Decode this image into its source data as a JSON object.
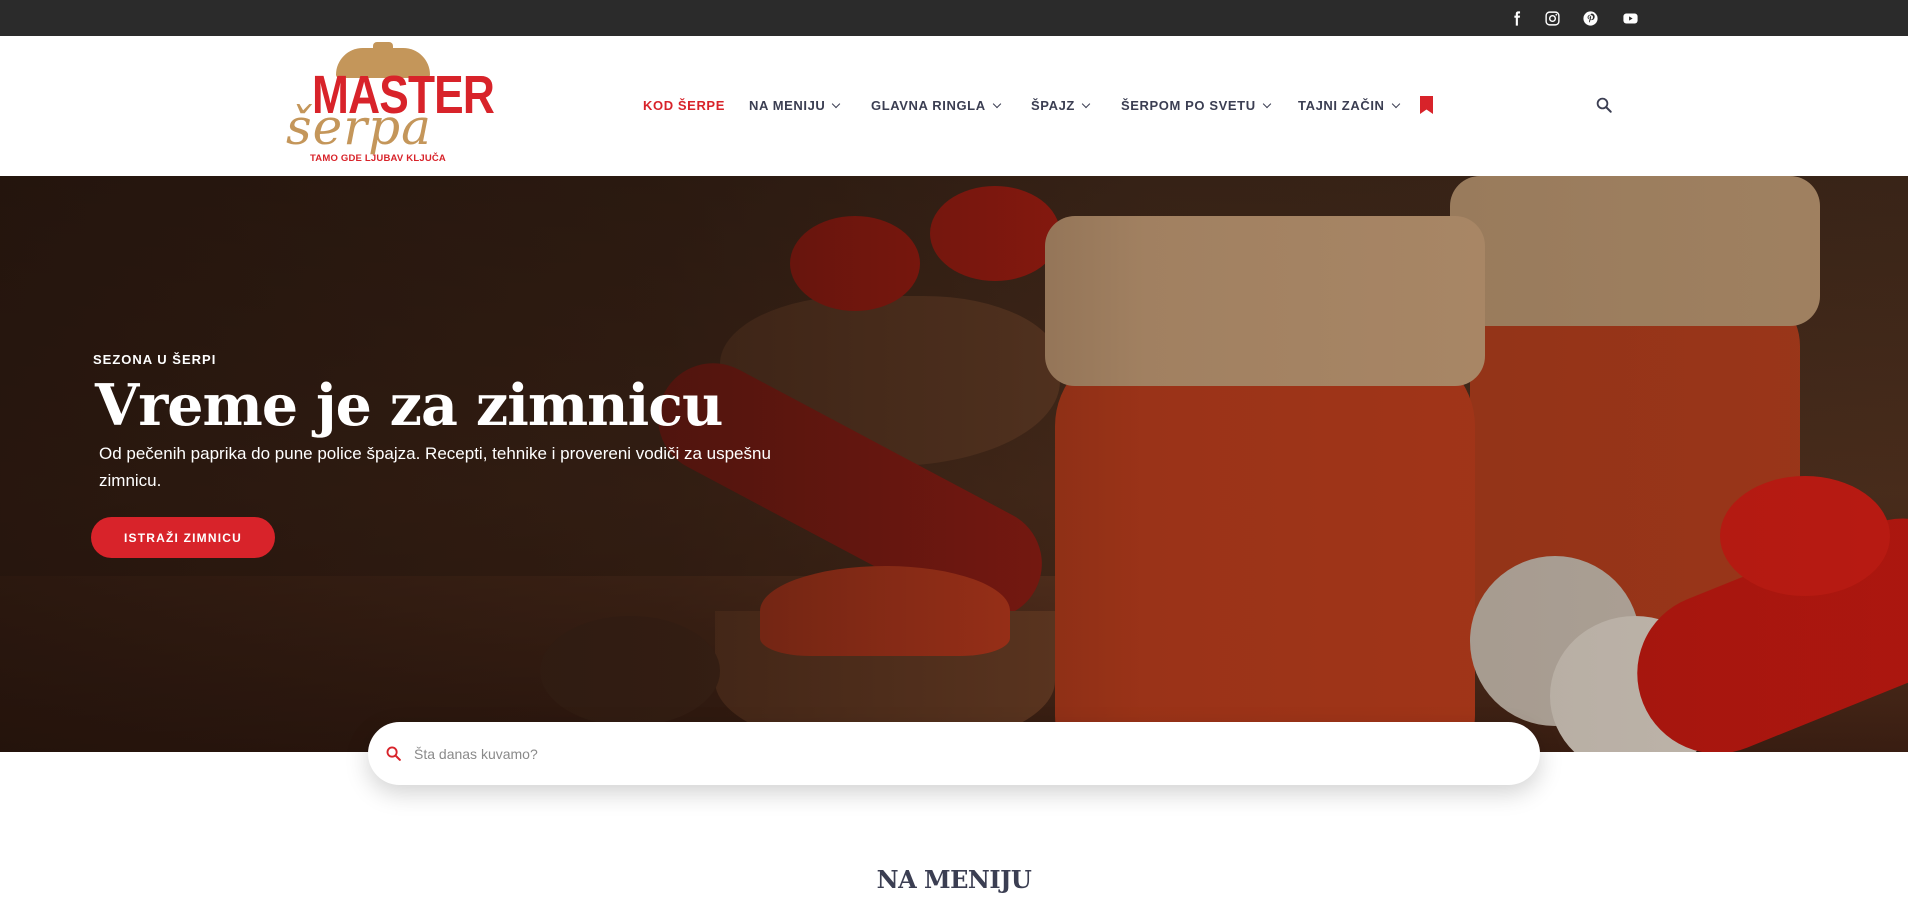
{
  "social": {
    "facebook_icon": "facebook-icon",
    "instagram_icon": "instagram-icon",
    "pinterest_icon": "pinterest-icon",
    "youtube_icon": "youtube-icon"
  },
  "logo": {
    "line1": "MASTER",
    "line2": "šerpa",
    "tagline": "TAMO GDE  LJUBAV KLJUČA"
  },
  "nav": {
    "items": [
      {
        "label": "KOD ŠERPE",
        "active": true,
        "has_dropdown": false
      },
      {
        "label": "NA MENIJU",
        "active": false,
        "has_dropdown": true
      },
      {
        "label": "GLAVNA RINGLA",
        "active": false,
        "has_dropdown": true
      },
      {
        "label": "ŠPAJZ",
        "active": false,
        "has_dropdown": true
      },
      {
        "label": "ŠERPOM PO SVETU",
        "active": false,
        "has_dropdown": true
      },
      {
        "label": "TAJNI ZAČIN",
        "active": false,
        "has_dropdown": true
      }
    ],
    "bookmark_icon": "bookmark-icon",
    "search_icon": "search-icon"
  },
  "hero": {
    "kicker": "SEZONA U ŠERPI",
    "title": "Vreme je za zimnicu",
    "text": "Od pečenih paprika do pune police špajza. Recepti, tehnike i provereni vodiči za uspešnu zimnicu.",
    "cta_label": "ISTRAŽI ZIMNICU"
  },
  "search": {
    "placeholder": "Šta danas kuvamo?",
    "value": ""
  },
  "section": {
    "title": "NA MENIJU"
  },
  "colors": {
    "brand_red": "#d8232a",
    "brand_gold": "#c4965a",
    "topbar": "#2b2b2b",
    "nav_text": "#3b3e52"
  }
}
